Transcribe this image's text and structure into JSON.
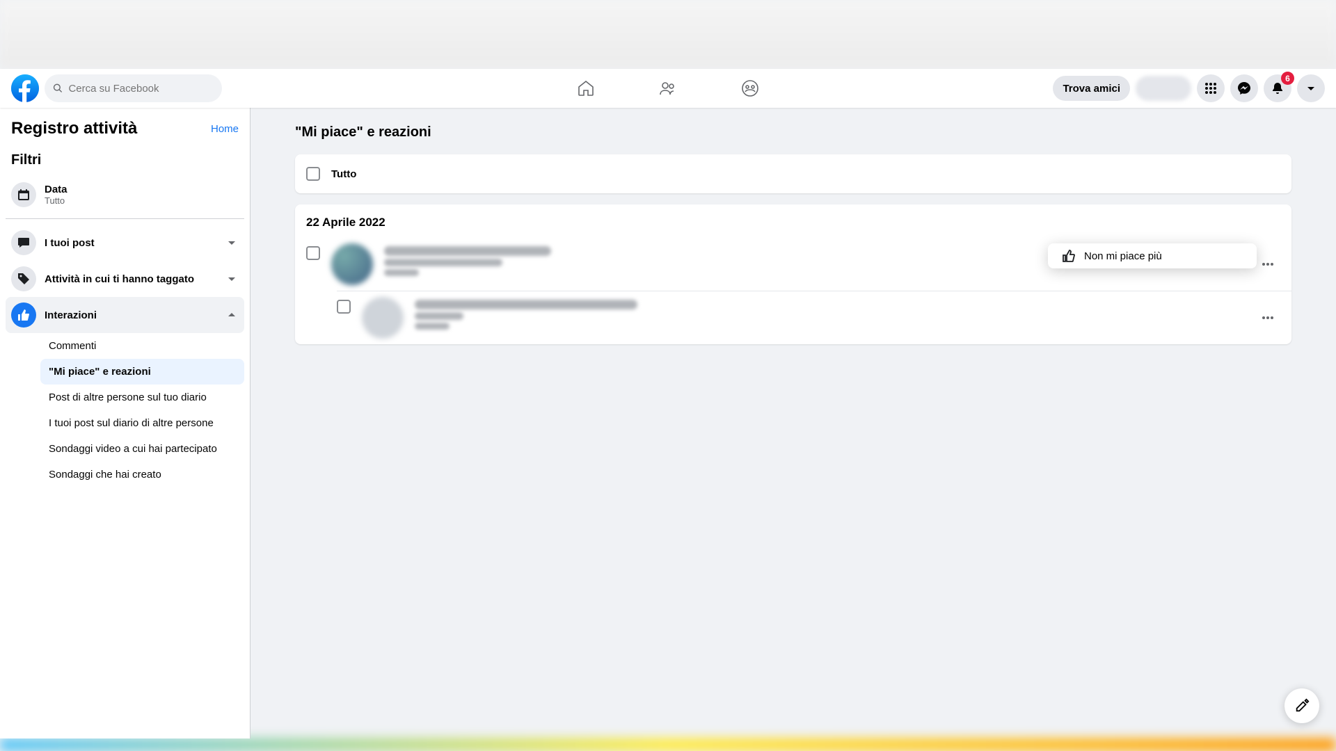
{
  "header": {
    "search_placeholder": "Cerca su Facebook",
    "find_friends": "Trova amici",
    "notification_count": "6"
  },
  "sidebar": {
    "title": "Registro attività",
    "home_link": "Home",
    "filters_title": "Filtri",
    "date": {
      "label": "Data",
      "value": "Tutto"
    },
    "items": [
      {
        "label": "I tuoi post"
      },
      {
        "label": "Attività in cui ti hanno taggato"
      },
      {
        "label": "Interazioni"
      }
    ],
    "sub_items": [
      "Commenti",
      "\"Mi piace\" e reazioni",
      "Post di altre persone sul tuo diario",
      "I tuoi post sul diario di altre persone",
      "Sondaggi video a cui hai partecipato",
      "Sondaggi che hai creato"
    ]
  },
  "main": {
    "heading": "\"Mi piace\" e reazioni",
    "all_label": "Tutto",
    "date_group": "22 Aprile 2022",
    "unlike_action": "Non mi piace più"
  }
}
